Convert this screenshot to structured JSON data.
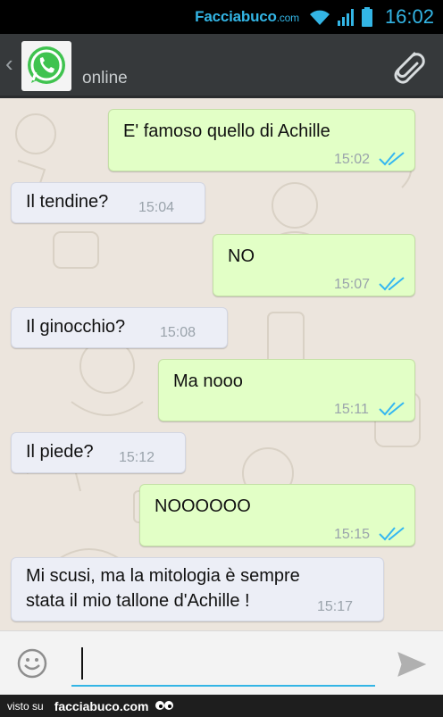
{
  "status_bar": {
    "brand": "Facciabuco",
    "brand_suffix": ".com",
    "time": "16:02"
  },
  "header": {
    "back_glyph": "‹",
    "contact_status": "online",
    "avatar_icon": "whatsapp-logo-icon",
    "attach_icon": "paperclip-icon"
  },
  "messages": [
    {
      "direction": "out",
      "text": "E' famoso quello di Achille",
      "time": "15:02",
      "read": true
    },
    {
      "direction": "in",
      "text": "Il tendine?",
      "time": "15:04"
    },
    {
      "direction": "out",
      "text": "NO",
      "time": "15:07",
      "read": true
    },
    {
      "direction": "in",
      "text": "Il ginocchio?",
      "time": "15:08"
    },
    {
      "direction": "out",
      "text": "Ma nooo",
      "time": "15:11",
      "read": true
    },
    {
      "direction": "in",
      "text": "Il piede?",
      "time": "15:12"
    },
    {
      "direction": "out",
      "text": "NOOOOOO",
      "time": "15:15",
      "read": true
    },
    {
      "direction": "in",
      "text_line1": "Mi scusi, ma la mitologia è sempre",
      "text_line2": "stata il mio tallone d'Achille !",
      "time": "15:17"
    }
  ],
  "input": {
    "value": "",
    "emoji_icon": "smiley-icon",
    "send_icon": "send-icon"
  },
  "footer": {
    "prefix": "visto su",
    "site": "facciabuco.com"
  },
  "colors": {
    "outgoing_bubble": "#e2ffc6",
    "incoming_bubble": "#eceef6",
    "header": "#36393b",
    "accent": "#33b5e5",
    "read_ticks": "#34b7f1"
  }
}
